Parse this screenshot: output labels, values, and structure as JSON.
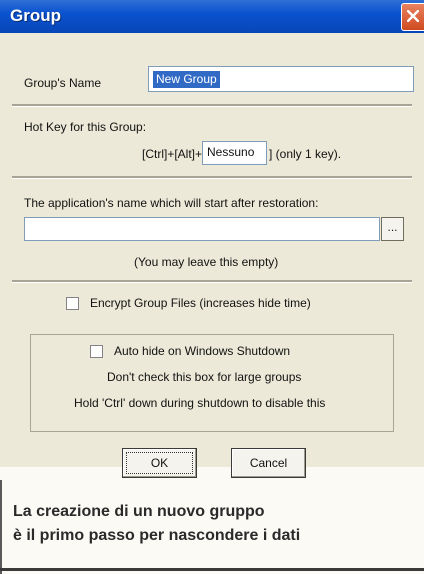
{
  "window": {
    "title": "Group"
  },
  "group_name": {
    "label": "Group's Name",
    "value": "New Group"
  },
  "hotkey": {
    "label": "Hot Key for this Group:",
    "prefix": "[Ctrl]+[Alt]+[",
    "value": "Nessuno",
    "suffix": "] (only 1 key)."
  },
  "application": {
    "label": "The application's name which will start after restoration:",
    "value": "",
    "browse_label": "...",
    "hint": "(You may leave this empty)"
  },
  "encrypt": {
    "label": "Encrypt Group Files (increases hide time)",
    "checked": false
  },
  "auto_hide": {
    "label": "Auto hide on Windows Shutdown",
    "checked": false,
    "note1": "Don't check this box for large groups",
    "note2": "Hold 'Ctrl' down during shutdown to disable this"
  },
  "buttons": {
    "ok": "OK",
    "cancel": "Cancel"
  },
  "caption": {
    "line1": "La creazione di un nuovo gruppo",
    "line2": "è il primo passo per nascondere i dati"
  },
  "colors": {
    "titlebar": "#0a52cf",
    "dialog": "#ece9d8",
    "selection": "#316ac5",
    "close": "#cf4a20"
  }
}
